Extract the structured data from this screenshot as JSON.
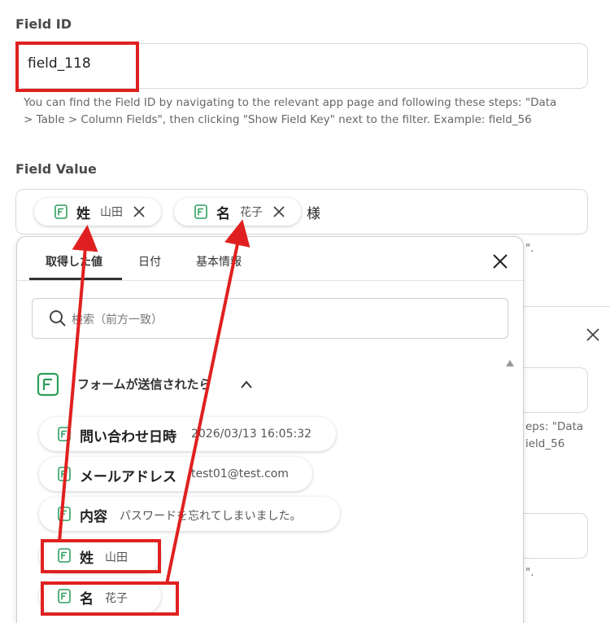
{
  "field_id": {
    "label": "Field ID",
    "value": "field_118",
    "help_line1": "You can find the Field ID by navigating to the relevant app page and following these steps: \"Data",
    "help_line2": "> Table > Column Fields\", then clicking \"Show Field Key\" next to the filter. Example: field_56"
  },
  "field_value": {
    "label": "Field Value",
    "chips": [
      {
        "main": "姓",
        "value": "山田"
      },
      {
        "main": "名",
        "value": "花子"
      }
    ],
    "suffix": "様",
    "help_fragment": "\"."
  },
  "background": {
    "help_fragment1": "eps: \"Data",
    "help_fragment2": "ield_56",
    "help_fragment3": "\"."
  },
  "dropdown": {
    "tabs": [
      "取得した値",
      "日付",
      "基本情報"
    ],
    "active_tab": "取得した値",
    "search_placeholder": "検索（前方一致）",
    "group_title": "フォームが送信されたら",
    "items": [
      {
        "name": "問い合わせ日時",
        "value": "2026/03/13 16:05:32"
      },
      {
        "name": "メールアドレス",
        "value": "test01@test.com"
      },
      {
        "name": "内容",
        "value": "パスワードを忘れてしまいました。"
      },
      {
        "name": "姓",
        "value": "山田"
      },
      {
        "name": "名",
        "value": "花子"
      }
    ]
  },
  "colors": {
    "accent_green": "#2e9e5e",
    "annotation_red": "#e02020",
    "border": "#d9d9d9"
  },
  "icons": [
    "form-icon",
    "close-icon",
    "search-icon",
    "chevron-up-icon",
    "scroll-up-icon"
  ]
}
